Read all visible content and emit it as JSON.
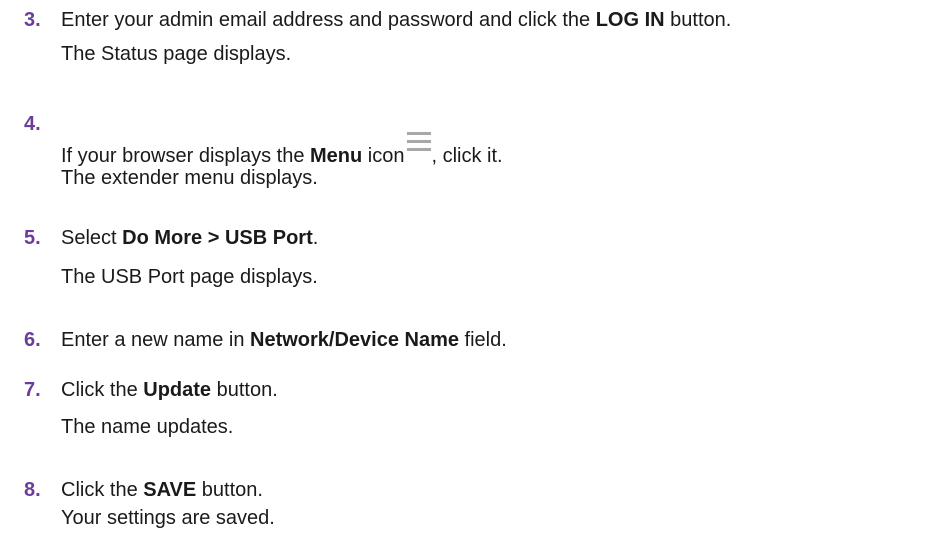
{
  "steps": [
    {
      "number": "3.",
      "lines": [
        [
          "Enter your admin email address and password and click the ",
          "LOG IN",
          " button."
        ],
        [
          "The Status page displays."
        ]
      ]
    },
    {
      "number": "4.",
      "lines": [
        [
          "If your browser displays the ",
          "Menu",
          " icon"
        ],
        [
          ", click it."
        ],
        [
          "The extender menu displays."
        ]
      ],
      "icon": "hamburger-menu-icon"
    },
    {
      "number": "5.",
      "lines": [
        [
          "Select ",
          "Do More > USB Port",
          "."
        ],
        [
          "The USB Port page displays."
        ]
      ]
    },
    {
      "number": "6.",
      "lines": [
        [
          "Enter a new name in ",
          "Network/Device Name",
          " field."
        ]
      ]
    },
    {
      "number": "7.",
      "lines": [
        [
          "Click the ",
          "Update",
          " button."
        ],
        [
          "The name updates."
        ]
      ]
    },
    {
      "number": "8.",
      "lines": [
        [
          "Click the ",
          "SAVE",
          " button."
        ],
        [
          "Your settings are saved."
        ]
      ]
    }
  ],
  "colors": {
    "step_number": "#6a3d9a",
    "body_text": "#1a1a1a",
    "icon": "#a8a8a8"
  }
}
